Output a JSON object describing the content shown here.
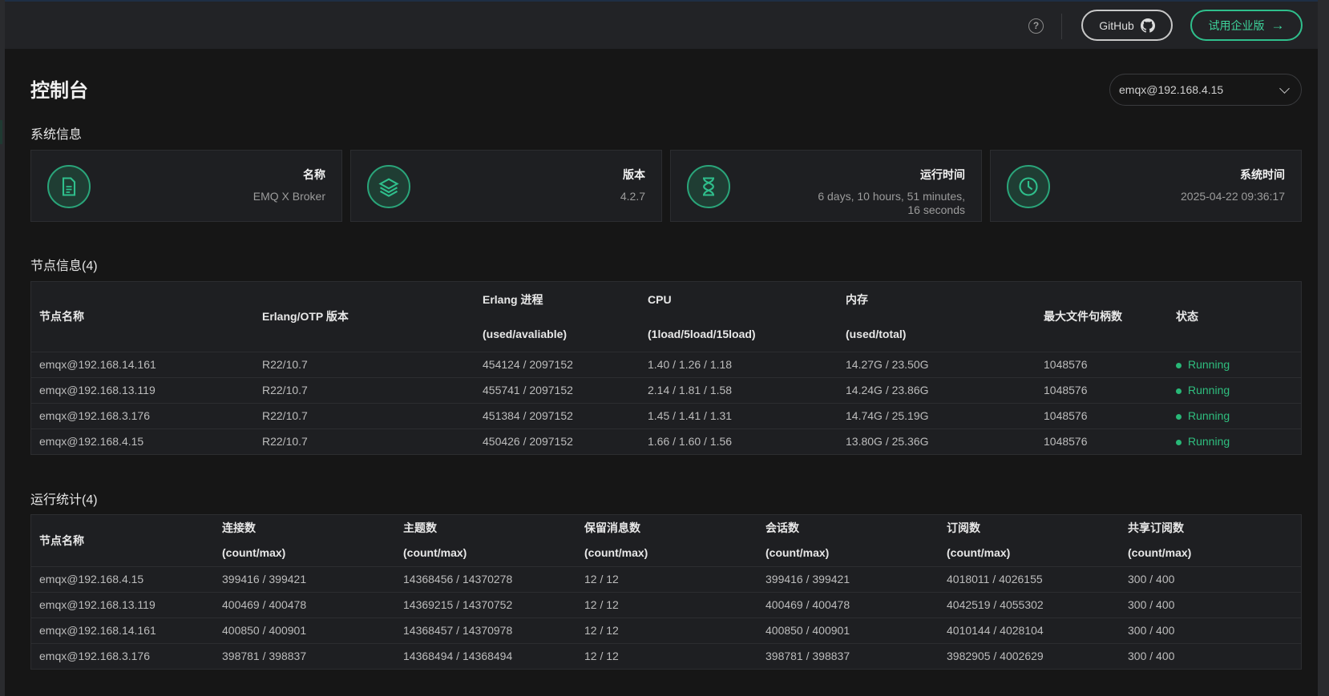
{
  "header": {
    "help_icon_glyph": "?",
    "github_label": "GitHub",
    "enterprise_label": "试用企业版",
    "enterprise_arrow": "→"
  },
  "page": {
    "title": "控制台",
    "node_selector": {
      "selected": "emqx@192.168.4.15"
    }
  },
  "system_info": {
    "title": "系统信息",
    "cards": [
      {
        "label": "名称",
        "value": "EMQ X Broker",
        "icon": "document-icon"
      },
      {
        "label": "版本",
        "value": "4.2.7",
        "icon": "layers-icon"
      },
      {
        "label": "运行时间",
        "value": "6 days, 10 hours, 51 minutes, 16 seconds",
        "icon": "hourglass-icon"
      },
      {
        "label": "系统时间",
        "value": "2025-04-22 09:36:17",
        "icon": "clock-icon"
      }
    ]
  },
  "nodes": {
    "title": "节点信息(4)",
    "headers": {
      "name": "节点名称",
      "otp": "Erlang/OTP 版本",
      "erlang_proc": "Erlang 进程",
      "erlang_proc_sub": "(used/avaliable)",
      "cpu": "CPU",
      "cpu_sub": "(1load/5load/15load)",
      "memory": "内存",
      "memory_sub": "(used/total)",
      "max_fds": "最大文件句柄数",
      "status": "状态"
    },
    "rows": [
      {
        "name": "emqx@192.168.14.161",
        "otp": "R22/10.7",
        "proc": "454124 / 2097152",
        "cpu": "1.40 / 1.26 / 1.18",
        "mem": "14.27G / 23.50G",
        "fds": "1048576",
        "status": "Running"
      },
      {
        "name": "emqx@192.168.13.119",
        "otp": "R22/10.7",
        "proc": "455741 / 2097152",
        "cpu": "2.14 / 1.81 / 1.58",
        "mem": "14.24G / 23.86G",
        "fds": "1048576",
        "status": "Running"
      },
      {
        "name": "emqx@192.168.3.176",
        "otp": "R22/10.7",
        "proc": "451384 / 2097152",
        "cpu": "1.45 / 1.41 / 1.31",
        "mem": "14.74G / 25.19G",
        "fds": "1048576",
        "status": "Running"
      },
      {
        "name": "emqx@192.168.4.15",
        "otp": "R22/10.7",
        "proc": "450426 / 2097152",
        "cpu": "1.66 / 1.60 / 1.56",
        "mem": "13.80G / 25.36G",
        "fds": "1048576",
        "status": "Running"
      }
    ]
  },
  "stats": {
    "title": "运行统计(4)",
    "headers": {
      "name": "节点名称",
      "connections": "连接数",
      "topics": "主题数",
      "retained": "保留消息数",
      "sessions": "会话数",
      "subscriptions": "订阅数",
      "shared_subs": "共享订阅数",
      "sub": "(count/max)"
    },
    "rows": [
      {
        "name": "emqx@192.168.4.15",
        "connections": "399416 / 399421",
        "topics": "14368456 / 14370278",
        "retained": "12 / 12",
        "sessions": "399416 / 399421",
        "subscriptions": "4018011 / 4026155",
        "shared": "300 / 400"
      },
      {
        "name": "emqx@192.168.13.119",
        "connections": "400469 / 400478",
        "topics": "14369215 / 14370752",
        "retained": "12 / 12",
        "sessions": "400469 / 400478",
        "subscriptions": "4042519 / 4055302",
        "shared": "300 / 400"
      },
      {
        "name": "emqx@192.168.14.161",
        "connections": "400850 / 400901",
        "topics": "14368457 / 14370978",
        "retained": "12 / 12",
        "sessions": "400850 / 400901",
        "subscriptions": "4010144 / 4028104",
        "shared": "300 / 400"
      },
      {
        "name": "emqx@192.168.3.176",
        "connections": "398781 / 398837",
        "topics": "14368494 / 14368494",
        "retained": "12 / 12",
        "sessions": "398781 / 398837",
        "subscriptions": "3982905 / 4002629",
        "shared": "300 / 400"
      }
    ]
  },
  "colors": {
    "accent": "#2fbf8c",
    "status_running": "#2fbf7f",
    "background": "#161616",
    "card": "#1e1f22"
  }
}
